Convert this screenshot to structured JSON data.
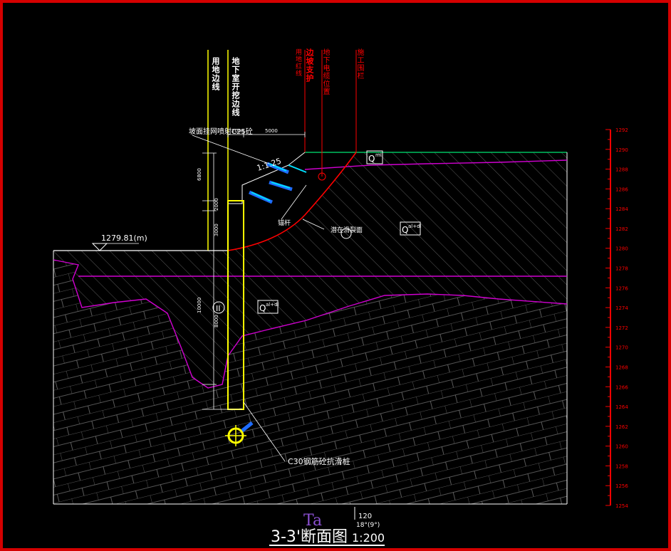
{
  "drawing": {
    "title_main": "3-3'断面图",
    "title_scale": "1:200",
    "elevation_mark": "1279.81(m)",
    "layer_label_top": "Q",
    "layer_label_top_sup": "ml",
    "layer_label_mid": "Q",
    "layer_label_mid_sup": "al+dl",
    "layer_label_low": "Q",
    "layer_label_low_sup": "al+dl",
    "rock_label": "Ta",
    "pile_tag": "II",
    "slope_ratio": "1:1.25",
    "note_spray": "坡面挂网喷射C25砼",
    "note_anchor": "锚杆",
    "note_slip": "潜在滑裂面",
    "note_pile": "C30钢筋砼抗滑桩",
    "strike_dip": "120",
    "strike_dip_sub": "18°(9°)"
  },
  "vertical_labels": {
    "boundary_line": "用地边线",
    "excavation_line": "地下室开挖边线",
    "red_line": "用地红线",
    "slope_support": "边坡支护",
    "pipe_position": "地下电缆位置",
    "construction_fence": "施工围栏"
  },
  "dimensions": {
    "top_left": "2000",
    "top_right": "5000",
    "left_upper": "6800",
    "left_mid1": "2000",
    "left_mid2": "3000",
    "left_lower": "10000",
    "pile_len": "8000"
  },
  "scale_bar": {
    "ticks": [
      "1292",
      "1290",
      "1288",
      "1286",
      "1284",
      "1282",
      "1280",
      "1278",
      "1276",
      "1274",
      "1272",
      "1270",
      "1268",
      "1266",
      "1264",
      "1262",
      "1260",
      "1258",
      "1256",
      "1254"
    ]
  },
  "colors": {
    "frame": "#d40000",
    "ground": "#ffffff",
    "boundary": "#d000d0",
    "pile": "#ffff00",
    "slip": "#ff0000",
    "anchor": "#1e6cff",
    "hatch": "#7a7a7a",
    "top_surface": "#00c060"
  }
}
